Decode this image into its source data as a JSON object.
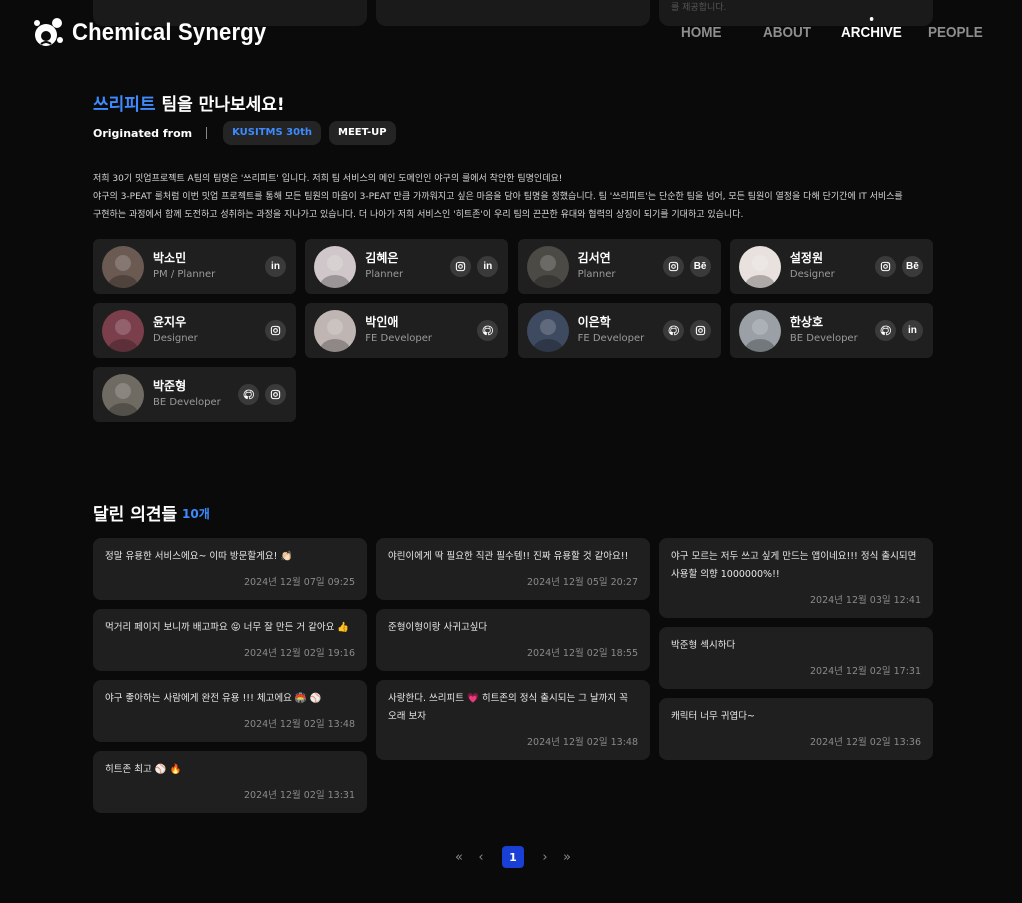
{
  "peek": {
    "right_text": "를 제공합니다."
  },
  "brand": {
    "name": "Chemical Synergy"
  },
  "nav": [
    {
      "label": "HOME",
      "active": false
    },
    {
      "label": "ABOUT",
      "active": false
    },
    {
      "label": "ARCHIVE",
      "active": true
    },
    {
      "label": "PEOPLE",
      "active": false
    }
  ],
  "team": {
    "name": "쓰리피트",
    "title_suffix": " 팀을 만나보세요!",
    "origin_label": "Originated from",
    "chips": [
      "KUSITMS 30th",
      "MEET-UP"
    ],
    "description": [
      "저희 30기 밋업프로젝트 A팀의 팀명은 '쓰리피트' 입니다. 저희 팀 서비스의 메인 도메인인 야구의 룰에서 착안한 팀명인데요!",
      "야구의 3-PEAT 룰처럼 이번 밋업 프로젝트를 통해 모든 팀원의 마음이 3-PEAT 만큼 가까워지고 싶은 마음을 담아 팀명을 정했습니다. 팀 '쓰리피트'는 단순한 팀을 넘어, 모든 팀원이 열정을 다해 단기간에 IT 서비스를",
      "구현하는 과정에서 함께 도전하고 성취하는 과정을 지나가고 있습니다. 더 나아가 저희 서비스인 '히트존'이 우리 팀의 끈끈한 유대와 협력의 상징이 되기를 기대하고 있습니다."
    ],
    "members": [
      {
        "name": "박소민",
        "role": "PM / Planner",
        "links": [
          "linkedin"
        ]
      },
      {
        "name": "김혜은",
        "role": "Planner",
        "links": [
          "instagram",
          "linkedin"
        ]
      },
      {
        "name": "김서연",
        "role": "Planner",
        "links": [
          "instagram",
          "behance"
        ]
      },
      {
        "name": "설정원",
        "role": "Designer",
        "links": [
          "instagram",
          "behance"
        ]
      },
      {
        "name": "윤지우",
        "role": "Designer",
        "links": [
          "instagram"
        ]
      },
      {
        "name": "박인애",
        "role": "FE Developer",
        "links": [
          "github"
        ]
      },
      {
        "name": "이은학",
        "role": "FE Developer",
        "links": [
          "github",
          "instagram"
        ]
      },
      {
        "name": "한상호",
        "role": "BE Developer",
        "links": [
          "github",
          "linkedin"
        ]
      },
      {
        "name": "박준형",
        "role": "BE Developer",
        "links": [
          "github",
          "instagram"
        ]
      }
    ]
  },
  "comments": {
    "title": "달린 의견들",
    "count": "10개",
    "columns": [
      [
        {
          "text": "정말 유용한 서비스에요~ 이따 방문할게요! 👏🏻",
          "date": "2024년 12월 07일 09:25"
        },
        {
          "text": "먹거리 페이지 보니까 배고파요 😝 너무 잘 만든 거 같아요 👍",
          "date": "2024년 12월 02일 19:16"
        },
        {
          "text": "야구 좋아하는 사람에게 완전 유용 !!! 체고에요 🏟️ ⚾",
          "date": "2024년 12월 02일 13:48"
        },
        {
          "text": "히트존 최고 ⚾ 🔥",
          "date": "2024년 12월 02일 13:31"
        }
      ],
      [
        {
          "text": "야린이에게 딱 필요한 직관 필수템!! 진짜 유용할 것 같아요!!",
          "date": "2024년 12월 05일 20:27"
        },
        {
          "text": "준형이형이랑 사귀고싶다",
          "date": "2024년 12월 02일 18:55"
        },
        {
          "text": "사랑한다. 쓰리피트 💗 히트존의 정식 출시되는 그 날까지 꼭 오래 보자",
          "date": "2024년 12월 02일 13:48"
        }
      ],
      [
        {
          "text": "야구 모르는 저두 쓰고 싶게 만드는 앱이네요!!! 정식 출시되면 사용할 의향 1000000%!!",
          "date": "2024년 12월 03일 12:41"
        },
        {
          "text": "박준형 섹시하다",
          "date": "2024년 12월 02일 17:31"
        },
        {
          "text": "캐릭터 너무 귀엽다~",
          "date": "2024년 12월 02일 13:36"
        }
      ]
    ]
  },
  "pagination": {
    "first": "«",
    "prev": "‹",
    "current": "1",
    "next": "›",
    "last": "»"
  },
  "colors": {
    "accent": "#3d8bff",
    "page_active": "#1a3fd6",
    "card": "#1f1f1f",
    "background": "#0a0a0a"
  }
}
